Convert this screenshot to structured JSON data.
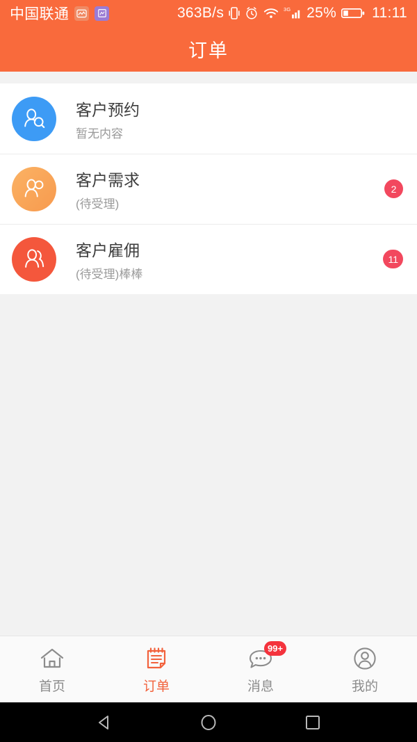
{
  "statusbar": {
    "carrier": "中国联通",
    "app_icon_1": "photo-app-icon",
    "app_icon_2": "qr-app-icon",
    "network_speed": "363B/s",
    "vibrate_icon": "vibrate-icon",
    "alarm_icon": "alarm-icon",
    "wifi_icon": "wifi-icon",
    "signal_label": "3G",
    "signal_icon": "signal-bars-icon",
    "battery_percent": "25%",
    "battery_icon": "battery-icon",
    "time": "11:11"
  },
  "header": {
    "title": "订单",
    "background": "#f96a3c"
  },
  "list": {
    "items": [
      {
        "title": "客户预约",
        "subtitle": "暂无内容",
        "avatar_icon": "person-search-icon",
        "avatar_color": "#3d9bf5",
        "badge": ""
      },
      {
        "title": "客户需求",
        "subtitle": "(待受理)",
        "avatar_icon": "two-people-icon",
        "avatar_color": "#f9a košice",
        "badge": "2"
      },
      {
        "title": "客户雇佣",
        "subtitle": "(待受理)棒棒",
        "avatar_icon": "two-people-icon",
        "avatar_color": "#f4573c",
        "badge": "11"
      }
    ],
    "badge_color": "#f2485e"
  },
  "tabbar": {
    "active_color": "#f2623c",
    "inactive_color": "#8c8c8c",
    "tabs": [
      {
        "label": "首页",
        "icon": "home-icon",
        "badge": ""
      },
      {
        "label": "订单",
        "icon": "order-notepad-icon",
        "badge": ""
      },
      {
        "label": "消息",
        "icon": "message-bubble-icon",
        "badge": "99+"
      },
      {
        "label": "我的",
        "icon": "person-circle-icon",
        "badge": ""
      }
    ]
  },
  "navbar": {
    "back_icon": "back-triangle-icon",
    "home_icon": "home-circle-icon",
    "recents_icon": "recents-square-icon"
  }
}
